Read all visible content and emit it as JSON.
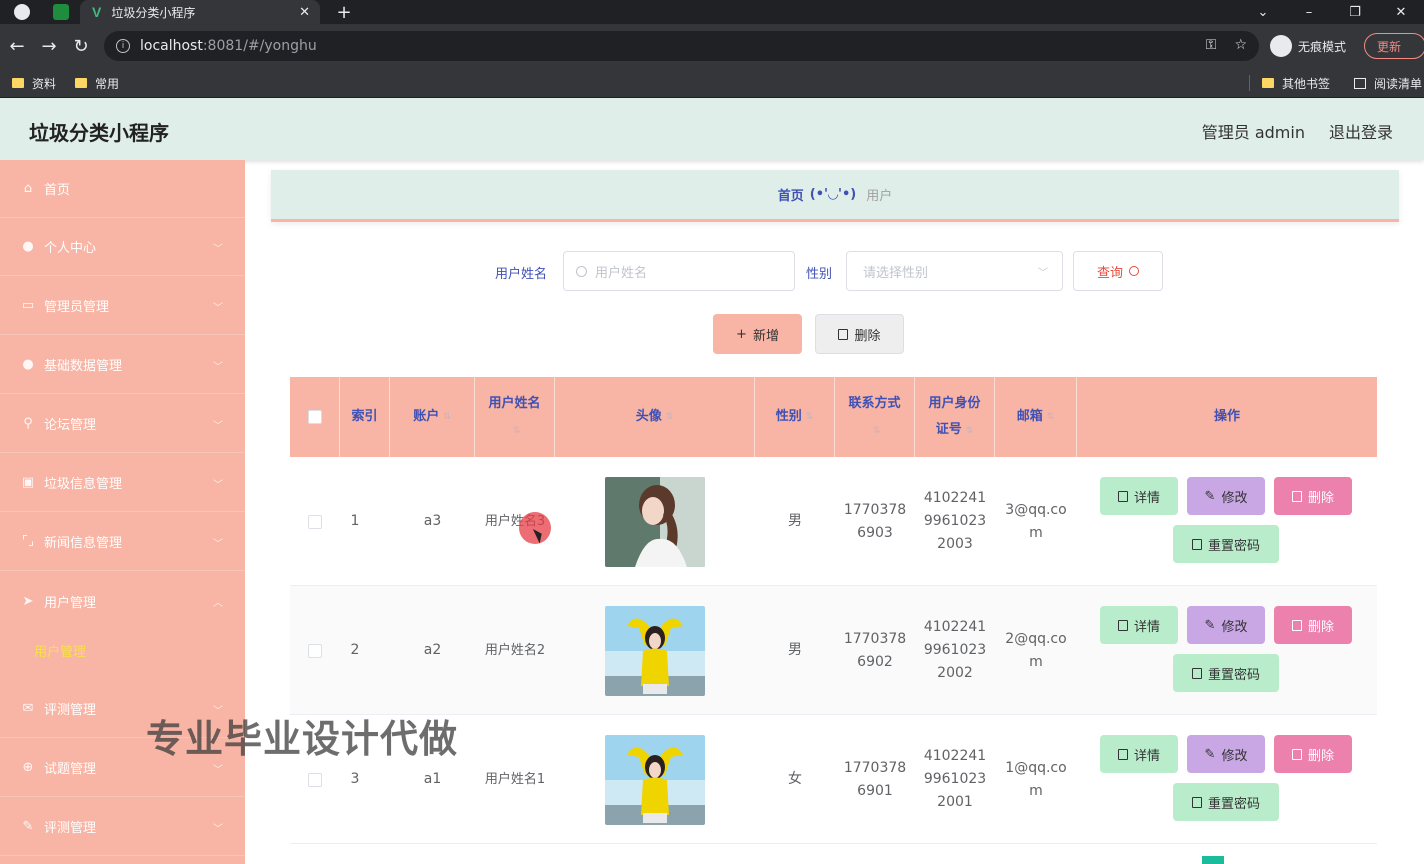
{
  "browser": {
    "tab_title": "垃圾分类小程序",
    "url_host": "localhost",
    "url_path": ":8081/#/yonghu",
    "incognito_label": "无痕模式",
    "update_label": "更新",
    "bookmarks": [
      "资料",
      "常用"
    ],
    "bookmarks_right": [
      "其他书签",
      "阅读清单"
    ]
  },
  "header": {
    "title": "垃圾分类小程序",
    "user": "管理员 admin",
    "logout": "退出登录"
  },
  "sidebar": {
    "items": [
      {
        "label": "首页",
        "icon": "home-icon"
      },
      {
        "label": "个人中心",
        "icon": "person-icon"
      },
      {
        "label": "管理员管理",
        "icon": "card-icon"
      },
      {
        "label": "基础数据管理",
        "icon": "person-icon"
      },
      {
        "label": "论坛管理",
        "icon": "pin-icon"
      },
      {
        "label": "垃圾信息管理",
        "icon": "trash-icon"
      },
      {
        "label": "新闻信息管理",
        "icon": "frame-icon"
      },
      {
        "label": "用户管理",
        "icon": "send-icon"
      },
      {
        "label": "评测管理",
        "icon": "mail-icon"
      },
      {
        "label": "试题管理",
        "icon": "globe-icon"
      },
      {
        "label": "评测管理",
        "icon": "edit-icon"
      }
    ],
    "active_sub": "用户管理"
  },
  "breadcrumb": {
    "home": "首页",
    "emoticon": "(•'◡'•)",
    "current": "用户"
  },
  "search": {
    "name_label": "用户姓名",
    "name_placeholder": "用户姓名",
    "gender_label": "性别",
    "gender_placeholder": "请选择性别",
    "query_label": "查询"
  },
  "actions": {
    "add_label": "新增",
    "delete_label": "删除"
  },
  "table": {
    "headers": {
      "index": "索引",
      "account": "账户",
      "name": "用户姓名",
      "avatar": "头像",
      "gender": "性别",
      "phone": "联系方式",
      "idcard": "用户身份证号",
      "email": "邮箱",
      "ops": "操作"
    },
    "rows": [
      {
        "index": "1",
        "account": "a3",
        "name": "用户姓名3",
        "gender": "男",
        "phone": "17703786903",
        "idcard": "410224199610232003",
        "email": "3@qq.com"
      },
      {
        "index": "2",
        "account": "a2",
        "name": "用户姓名2",
        "gender": "男",
        "phone": "17703786902",
        "idcard": "410224199610232002",
        "email": "2@qq.com"
      },
      {
        "index": "3",
        "account": "a1",
        "name": "用户姓名1",
        "gender": "女",
        "phone": "17703786901",
        "idcard": "410224199610232001",
        "email": "1@qq.com"
      }
    ],
    "row_ops": {
      "detail": "详情",
      "edit": "修改",
      "delete": "删除",
      "reset": "重置密码"
    }
  },
  "watermark": "专业毕业设计代做",
  "colors": {
    "accent": "#f8b4a4",
    "header_bg": "#dfeee8",
    "link_blue": "#3f51b5",
    "detail_btn": "#b8eccb",
    "edit_btn": "#c9a6e4",
    "delete_btn": "#ec81ad"
  }
}
